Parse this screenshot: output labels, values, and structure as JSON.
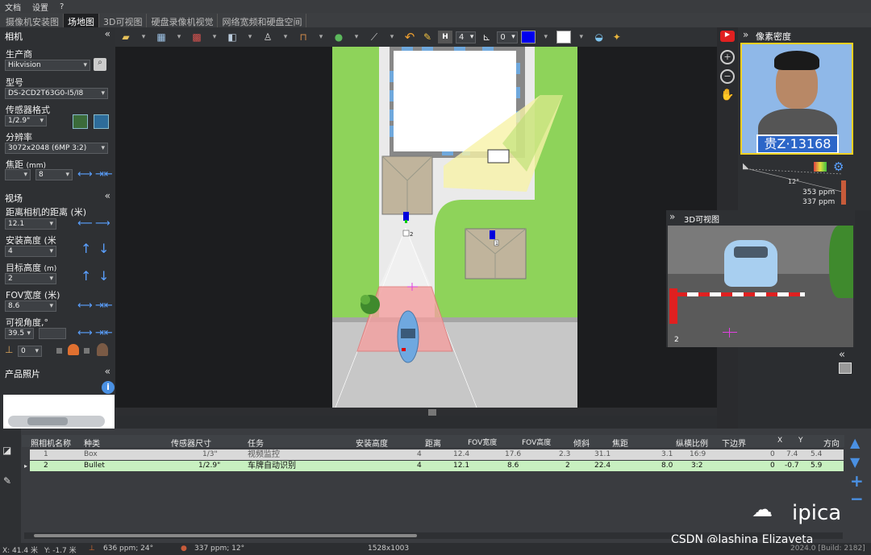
{
  "menu": {
    "items": [
      "文档",
      "设置",
      "?"
    ]
  },
  "tabs": [
    "摄像机安装图",
    "场地图",
    "3D可视图",
    "硬盘录像机视觉",
    "网络宽频和硬盘空间"
  ],
  "camera_section": {
    "title": "相机",
    "manufacturer_label": "生产商",
    "manufacturer_value": "Hikvision",
    "model_label": "型号",
    "model_value": "DS-2CD2T63G0-I5/I8",
    "sensor_label": "传感器格式",
    "sensor_value": "1/2.9\"",
    "resolution_label": "分辨率",
    "resolution_value": "3072x2048 (6MP 3:2)",
    "focal_label": "焦距",
    "focal_unit": "(mm)",
    "focal_min": "",
    "focal_value": "8"
  },
  "fov_section": {
    "title": "视场",
    "distance_label": "距离相机的距离",
    "distance_unit": "(米)",
    "distance_value": "12.1",
    "install_height_label": "安装高度",
    "install_height_unit": "(米",
    "install_height_value": "4",
    "target_height_label": "目标高度",
    "target_height_unit": "(m)",
    "target_height_value": "2",
    "fov_width_label": "FOV宽度",
    "fov_width_unit": "(米)",
    "fov_width_value": "8.6",
    "view_angle_label": "可视角度,°",
    "view_angle_value": "39.5",
    "view_angle_extra": "",
    "tilt_value": "0"
  },
  "product_section": {
    "title": "产品照片"
  },
  "toolbar": {
    "h_value": "4",
    "angle_value": "0"
  },
  "pixel_density": {
    "title": "像素密度",
    "plate_text": "贵Z·13168",
    "angle": "12°",
    "ppm1": "353 ppm",
    "ppm2": "337 ppm"
  },
  "view3d": {
    "title": "3D可视图",
    "camera_index": "2"
  },
  "site": {
    "cam1_label": "1",
    "cam2_label": "2"
  },
  "table": {
    "headers": [
      "照相机名称",
      "种类",
      "传感器尺寸",
      "任务",
      "安装高度",
      "距离",
      "FOV宽度",
      "FOV高度",
      "倾斜",
      "焦距",
      "纵横比例",
      "下边界",
      "X",
      "Y",
      "方向"
    ],
    "rows": [
      {
        "name": "1",
        "type": "Box",
        "sensor": "1/3\"",
        "task": "视频监控",
        "height": "4",
        "distance": "12.4",
        "fov_w": "17.6",
        "fov_h": "2.3",
        "tilt": "31.1",
        "focal": "3.1",
        "aspect": "16:9",
        "lower": "0",
        "x": "7.4",
        "y": "5.4"
      },
      {
        "name": "2",
        "type": "Bullet",
        "sensor": "1/2.9\"",
        "task": "车牌自动识别",
        "height": "4",
        "distance": "12.1",
        "fov_w": "8.6",
        "fov_h": "2",
        "tilt": "22.4",
        "focal": "8.0",
        "aspect": "3:2",
        "lower": "0",
        "x": "-0.7",
        "y": "5.9"
      }
    ]
  },
  "status": {
    "x": "X: 41.4 米",
    "y": "Y: -1.7 米",
    "ppm1": "636 ppm; 24°",
    "ppm2": "337 ppm; 12°",
    "resolution": "1528x1003",
    "build": "2024.0 [Build: 2182]"
  },
  "watermark": {
    "brand": "ipica",
    "csdn": "CSDN @lashina Elizaveta"
  },
  "colors": {
    "accent": "#5aa0ff",
    "selected_row": "#c8f0c0",
    "grass": "#8ed35a",
    "fov": "#f4a0a0",
    "frame_yellow": "#f0d020"
  }
}
